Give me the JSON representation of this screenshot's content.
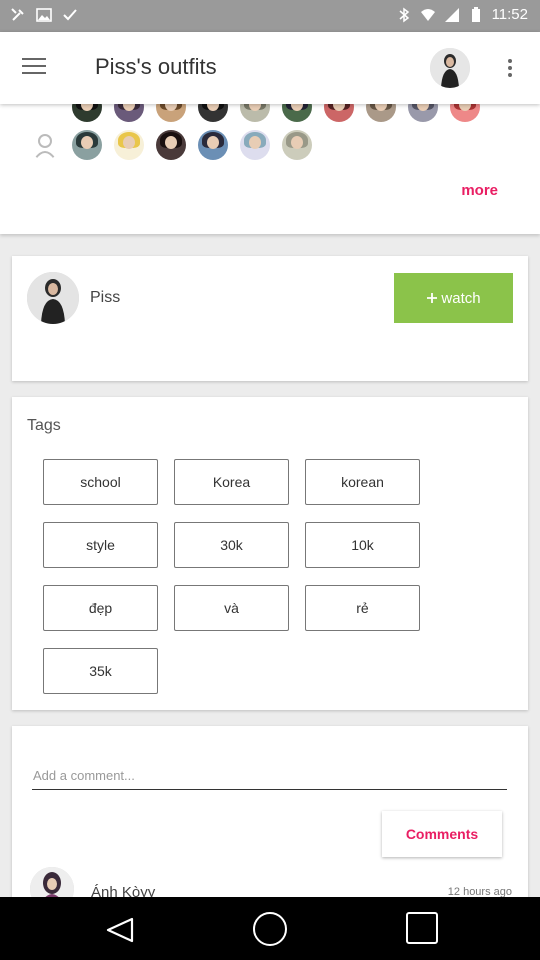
{
  "status_bar": {
    "time": "11:52",
    "icons": [
      "tools-icon",
      "image-icon",
      "check-icon",
      "bluetooth-icon",
      "wifi-icon",
      "signal-icon",
      "battery-icon"
    ]
  },
  "app_bar": {
    "title": "Piss's outfits",
    "menu_icon": "hamburger-icon",
    "overflow_icon": "more-vert-icon"
  },
  "followers": {
    "more_label": "more",
    "accent_color": "#e91e63"
  },
  "owner": {
    "name": "Piss",
    "watch_label": "watch",
    "watch_color": "#8bc34a"
  },
  "tags": {
    "title": "Tags",
    "items": [
      "school",
      "Korea",
      "korean",
      "style",
      "30k",
      "10k",
      "đẹp",
      "và",
      "rẻ",
      "35k"
    ]
  },
  "comments": {
    "input_placeholder": "Add a comment...",
    "button_label": "Comments",
    "first": {
      "author": "Ánh Kòyy",
      "time": "12 hours ago"
    }
  }
}
